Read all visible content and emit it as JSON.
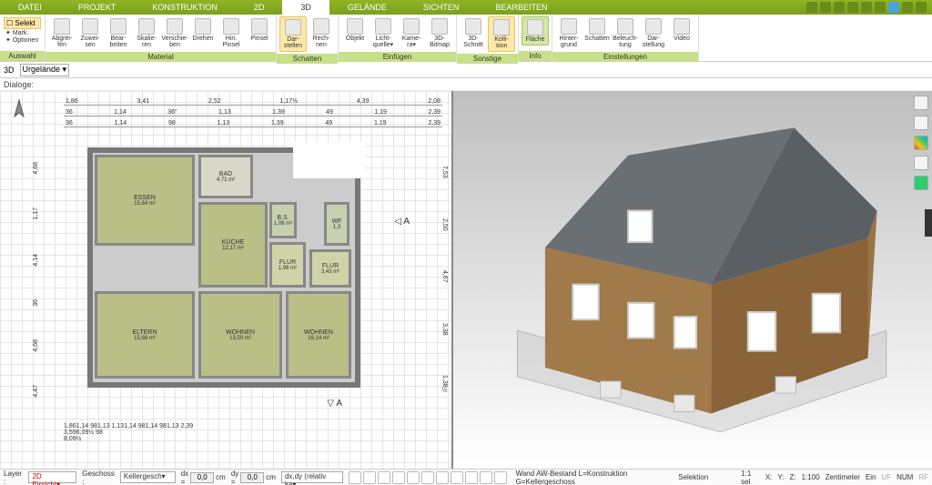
{
  "menu": {
    "tabs": [
      "DATEI",
      "PROJEKT",
      "KONSTRUKTION",
      "2D",
      "3D",
      "GELÄNDE",
      "SICHTEN",
      "BEARBEITEN"
    ],
    "active_index": 4
  },
  "ribbon": {
    "auswahl": {
      "label": "Auswahl",
      "selekt": "Selekt",
      "mark": "Mark.",
      "optionen": "Optionen"
    },
    "material": {
      "label": "Material",
      "buttons": [
        "Abgrei-\nfen",
        "Zuwei-\nsen",
        "Bear-\nbeiten",
        "Skalie-\nren",
        "Verschie-\nben",
        "Drehen",
        "Hin.\nPinsel",
        "Pinsel"
      ]
    },
    "schatten": {
      "label": "Schatten",
      "buttons": [
        "Dar-\nstellen",
        "Rech-\nnen"
      ]
    },
    "einfuegen": {
      "label": "Einfügen",
      "buttons": [
        "Objekt",
        "Licht-\nquelle▾",
        "Kame-\nra▾",
        "3D-\nBitmap"
      ]
    },
    "sonstige": {
      "label": "Sonstige",
      "buttons": [
        "3D-\nSchnitt",
        "Kolli-\nsion"
      ]
    },
    "info": {
      "label": "Info",
      "buttons": [
        "Fläche"
      ]
    },
    "einstellungen": {
      "label": "Einstellungen",
      "buttons": [
        "Hinter-\ngrund",
        "Schatten",
        "Beleuch-\ntung",
        "Dar-\nstellung",
        "Video"
      ]
    }
  },
  "subbar": {
    "mode": "3D",
    "layer": "Urgelände",
    "dialoge": "Dialoge:"
  },
  "plan": {
    "dims_top": {
      "row1": [
        "1,86",
        "3,41",
        "2,52",
        "1,17½",
        "4,39",
        "2,08"
      ],
      "row2": [
        "36",
        "1,14",
        "36°",
        "1,13",
        "1,39",
        "49",
        "1,19",
        "2,39"
      ],
      "row3": [
        "36",
        "1,14",
        "98",
        "1,13",
        "1,39",
        "49",
        "1,19",
        "2,39"
      ]
    },
    "dims_left": [
      "4,68",
      "1,17",
      "4,14",
      "36",
      "4,68",
      "4,47"
    ],
    "dims_right": [
      "7,53",
      "2,50",
      "4,67",
      "3,38",
      "1,38½"
    ],
    "dims_bottom": {
      "row1": [
        "1,86",
        "1,14",
        "98",
        "1,13",
        "1,13",
        "1,14",
        "98",
        "1,14",
        "98",
        "1,13",
        "2,39"
      ],
      "row2": [
        "3,59",
        "6,09½",
        "98"
      ],
      "row3": [
        "8,09½"
      ]
    },
    "rooms": {
      "essen": {
        "name": "ESSEN",
        "area": "15,84 m²"
      },
      "bad": {
        "name": "BAD",
        "area": "4,71 m²"
      },
      "kueche": {
        "name": "KÜCHE",
        "area": "12,17 m²"
      },
      "bs": {
        "name": "B.S.",
        "area": "1,08 m²"
      },
      "wf": {
        "name": "WF",
        "area": "1,3"
      },
      "flur1": {
        "name": "FLUR",
        "area": "1,96 m²"
      },
      "flur2": {
        "name": "FLUR",
        "area": "3,43 m²"
      },
      "eltern": {
        "name": "ELTERN",
        "area": "15,68 m²"
      },
      "wohnen1": {
        "name": "WOHNEN",
        "area": "13,50 m²"
      },
      "wohnen2": {
        "name": "WOHNEN",
        "area": "16,14 m²"
      }
    },
    "section": "A"
  },
  "status": {
    "layer_label": "Layer :",
    "layer_value": "2D Einricht",
    "geschoss_label": "Geschoss :",
    "geschoss_value": "Kellergesch",
    "dx_label": "dx =",
    "dx_value": "0,0",
    "dy_label": "dy =",
    "dy_value": "0,0",
    "unit": "cm",
    "coord_mode": "dx,dy (relativ ka",
    "wand_text": "Wand AW-Bestand L=Konstruktion G=Kellergeschoss",
    "selektion": "Selektion",
    "scale": "1:1 sel",
    "x": "X:",
    "y": "Y:",
    "z": "Z:",
    "scale2": "1:100",
    "units2": "Zentimeter",
    "ein": "Ein",
    "uf": "UF",
    "num": "NUM",
    "rf": "RF"
  },
  "side_tools": [
    "layers-icon",
    "furniture-icon",
    "materials-icon",
    "search-icon",
    "tree-icon"
  ]
}
